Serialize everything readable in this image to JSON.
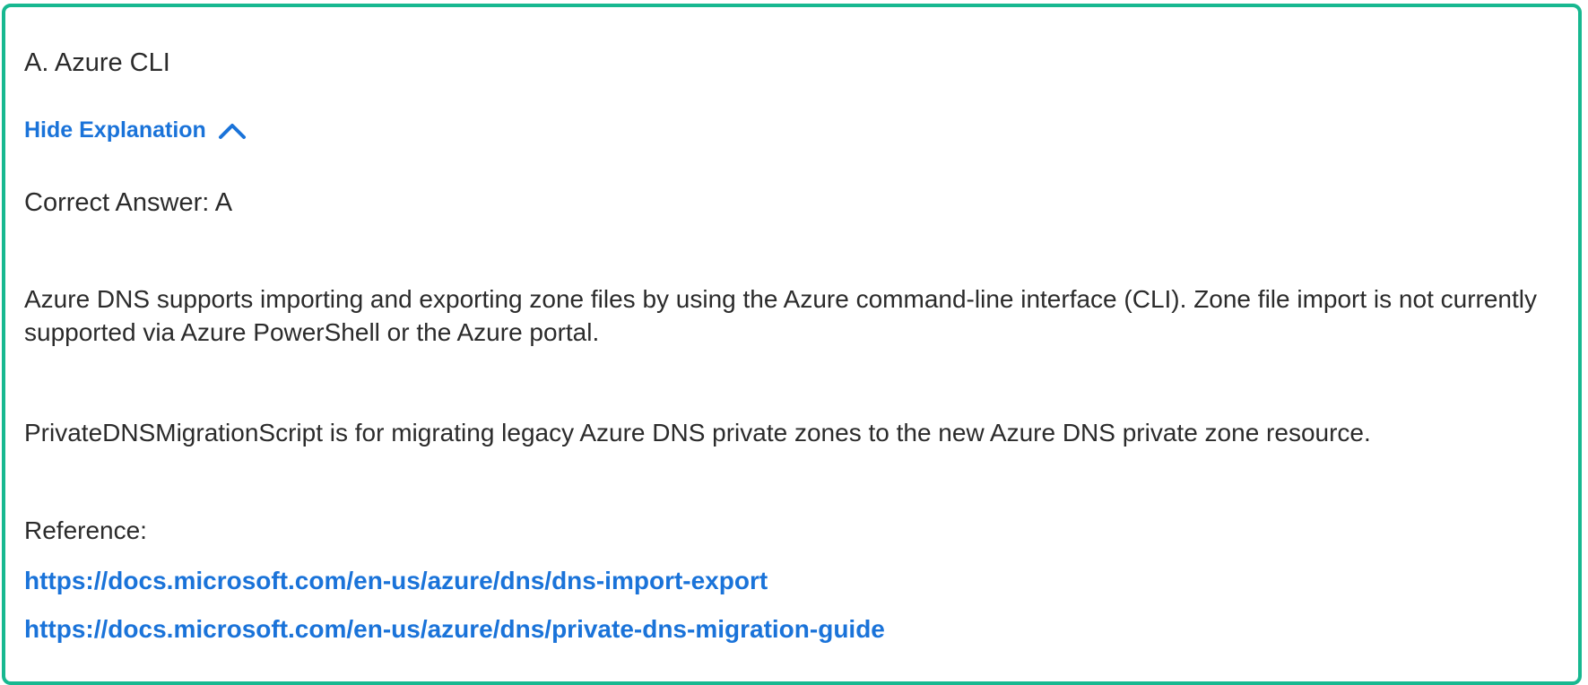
{
  "option": {
    "text": "A. Azure CLI"
  },
  "explanation_toggle": {
    "label": "Hide Explanation",
    "icon": "chevron-up-icon",
    "color": "#1a73d9"
  },
  "explanation": {
    "correct_answer": "Correct Answer: A",
    "paragraphs": [
      "Azure DNS supports importing and exporting zone files by using the Azure command-line interface (CLI). Zone file import is not currently supported via Azure PowerShell or the Azure portal.",
      "PrivateDNSMigrationScript is for migrating legacy Azure DNS private zones to the new Azure DNS private zone resource."
    ],
    "reference_label": "Reference:",
    "links": [
      "https://docs.microsoft.com/en-us/azure/dns/dns-import-export",
      "https://docs.microsoft.com/en-us/azure/dns/private-dns-migration-guide"
    ]
  },
  "colors": {
    "border": "#17b890",
    "link": "#1a73d9",
    "text": "#2b2b2b"
  }
}
